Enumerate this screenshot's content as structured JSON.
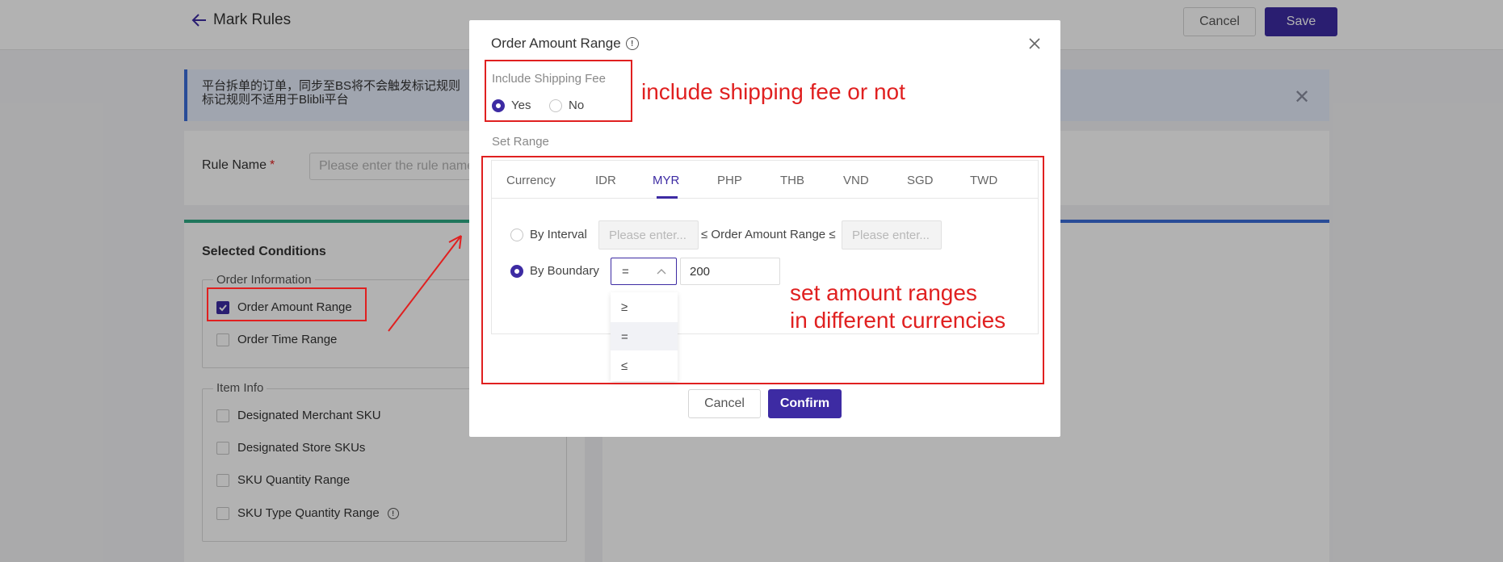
{
  "header": {
    "back_label": "Mark Rules",
    "cancel_label": "Cancel",
    "save_label": "Save"
  },
  "notice": {
    "line1": "平台拆单的订单，同步至BS将不会触发标记规则",
    "line2": "标记规则不适用于Blibli平台"
  },
  "rule_name": {
    "label": "Rule Name",
    "required_mark": "*",
    "placeholder": "Please enter the rule name"
  },
  "selected_conditions": {
    "title": "Selected Conditions",
    "order_information": {
      "legend": "Order Information",
      "items": [
        {
          "label": "Order Amount Range",
          "checked": true
        },
        {
          "label": "Order Time Range",
          "checked": false
        }
      ]
    },
    "item_info": {
      "legend": "Item Info",
      "items": [
        {
          "label": "Designated Merchant SKU",
          "checked": false
        },
        {
          "label": "Designated Store SKUs",
          "checked": false
        },
        {
          "label": "SKU Quantity Range",
          "checked": false
        },
        {
          "label": "SKU Type Quantity Range",
          "checked": false,
          "icon": "info-icon"
        }
      ]
    }
  },
  "modal": {
    "title": "Order Amount Range",
    "title_icon": "info-icon",
    "shipping": {
      "label": "Include Shipping Fee",
      "options": [
        "Yes",
        "No"
      ],
      "selected": "Yes"
    },
    "set_range_label": "Set Range",
    "tabs": [
      "Currency",
      "IDR",
      "MYR",
      "PHP",
      "THB",
      "VND",
      "SGD",
      "TWD"
    ],
    "active_tab": "MYR",
    "by_interval": {
      "label": "By Interval",
      "min_placeholder": "Please enter...",
      "middle_text": "≤ Order Amount Range ≤",
      "max_placeholder": "Please enter...",
      "selected": false
    },
    "by_boundary": {
      "label": "By Boundary",
      "operator": "=",
      "value": "200",
      "selected": true
    },
    "operator_options": [
      "≥",
      "=",
      "≤"
    ],
    "selected_operator": "=",
    "cancel_label": "Cancel",
    "confirm_label": "Confirm"
  },
  "annotations": {
    "shipping_note": "include shipping fee or not",
    "range_note_line1": "set amount ranges",
    "range_note_line2": "in different currencies",
    "color": "#e02020"
  },
  "colors": {
    "primary": "#3d2ba3",
    "notice_bg": "#e6ecfb",
    "green_accent": "#2eaa84",
    "blue_accent": "#3b6ed8"
  }
}
